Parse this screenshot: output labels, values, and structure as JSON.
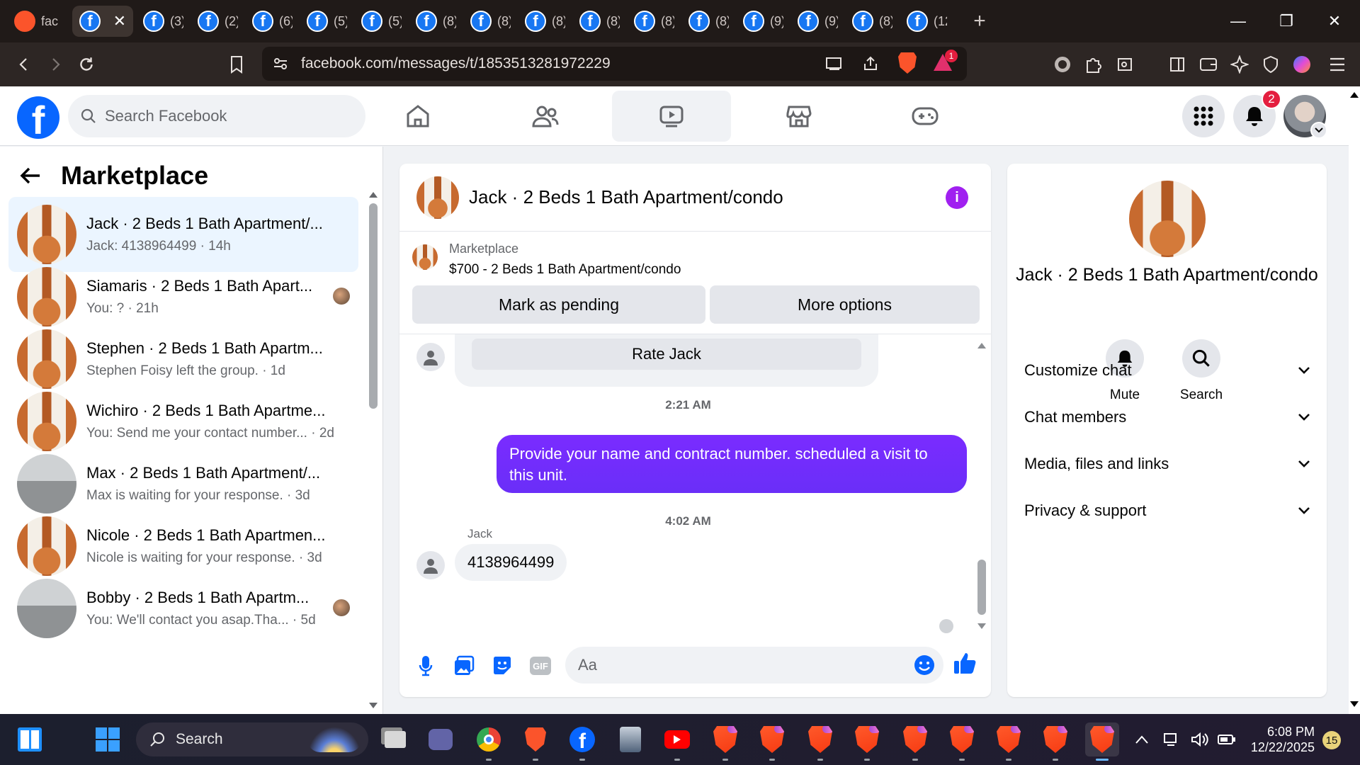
{
  "browser": {
    "tabs": [
      {
        "label": "fac",
        "icon": "brave-icon"
      },
      {
        "label": "",
        "icon": "facebook-icon",
        "active": true
      },
      {
        "label": "(3)",
        "icon": "facebook-icon"
      },
      {
        "label": "(2)",
        "icon": "facebook-icon"
      },
      {
        "label": "(6)",
        "icon": "facebook-icon"
      },
      {
        "label": "(5)",
        "icon": "facebook-icon"
      },
      {
        "label": "(5)",
        "icon": "facebook-icon"
      },
      {
        "label": "(8)",
        "icon": "facebook-icon"
      },
      {
        "label": "(8)",
        "icon": "facebook-icon"
      },
      {
        "label": "(8)",
        "icon": "facebook-icon"
      },
      {
        "label": "(8)",
        "icon": "facebook-icon"
      },
      {
        "label": "(8)",
        "icon": "facebook-icon"
      },
      {
        "label": "(8)",
        "icon": "facebook-icon"
      },
      {
        "label": "(9)",
        "icon": "facebook-icon"
      },
      {
        "label": "(9)",
        "icon": "facebook-icon"
      },
      {
        "label": "(8)",
        "icon": "facebook-icon"
      },
      {
        "label": "(12",
        "icon": "facebook-icon"
      }
    ],
    "url": "facebook.com/messages/t/1853513281972229",
    "brave_badge": "1"
  },
  "facebook": {
    "search_placeholder": "Search Facebook",
    "notifications_count": "2",
    "nav": [
      "home-icon",
      "friends-icon",
      "video-icon",
      "marketplace-icon",
      "gaming-icon"
    ],
    "accent": "#0866ff"
  },
  "sidebar": {
    "title": "Marketplace",
    "conversations": [
      {
        "name": "Jack · 2 Beds 1 Bath Apartment/...",
        "preview": "Jack: 4138964499 · 14h",
        "selected": true
      },
      {
        "name": "Siamaris · 2 Beds 1 Bath Apart...",
        "preview": "You: ? · 21h"
      },
      {
        "name": "Stephen · 2 Beds 1 Bath Apartm...",
        "preview": "Stephen Foisy left the group. · 1d"
      },
      {
        "name": "Wichiro · 2 Beds 1 Bath Apartme...",
        "preview": "You: Send me your contact number... · 2d"
      },
      {
        "name": "Max · 2 Beds 1 Bath Apartment/...",
        "preview": "Max is waiting for your response. · 3d"
      },
      {
        "name": "Nicole · 2 Beds 1 Bath Apartmen...",
        "preview": "Nicole is waiting for your response. · 3d"
      },
      {
        "name": "Bobby · 2 Beds 1 Bath Apartm...",
        "preview": "You: We'll contact you asap.Tha... · 5d"
      }
    ]
  },
  "chat": {
    "title": "Jack · 2 Beds 1 Bath Apartment/condo",
    "listing_label": "Marketplace",
    "listing_title": "$700 - 2 Beds 1 Bath Apartment/condo",
    "mark_pending": "Mark as pending",
    "more_options": "More options",
    "rate_label": "Rate Jack",
    "time1": "2:21 AM",
    "my_message": "Provide your name and contract number. scheduled a visit to this unit.",
    "time2": "4:02 AM",
    "sender": "Jack",
    "their_message": "4138964499",
    "input_placeholder": "Aa",
    "bubble_color": "#7a2cff"
  },
  "info": {
    "name": "Jack · 2 Beds 1 Bath Apartment/condo",
    "mute": "Mute",
    "search": "Search",
    "sections": [
      "Customize chat",
      "Chat members",
      "Media, files and links",
      "Privacy & support"
    ]
  },
  "taskbar": {
    "search": "Search",
    "time": "6:08 PM",
    "date": "12/22/2025",
    "notif_count": "15"
  }
}
